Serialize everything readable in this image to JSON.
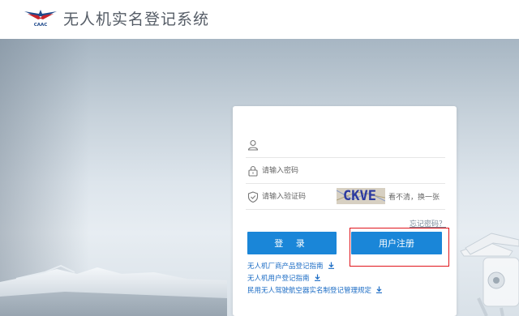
{
  "header": {
    "logo_text": "CAAC",
    "title": "无人机实名登记系统"
  },
  "login": {
    "username_value": "",
    "password_placeholder": "请输入密码",
    "captcha_placeholder": "请输入验证码",
    "captcha_text": "CKVE",
    "captcha_refresh": "看不清，换一张",
    "forgot_password": "忘记密码？",
    "login_button": "登 录",
    "register_button": "用户注册"
  },
  "links": [
    {
      "label": "无人机厂商产品登记指南"
    },
    {
      "label": "无人机用户登记指南"
    },
    {
      "label": "民用无人驾驶航空器实名制登记管理规定"
    }
  ],
  "colors": {
    "primary": "#1a86d8",
    "highlight_border": "#e0141b",
    "link": "#1a6bc4"
  },
  "icons": [
    "user-icon",
    "lock-icon",
    "shield-check-icon",
    "download-icon"
  ]
}
